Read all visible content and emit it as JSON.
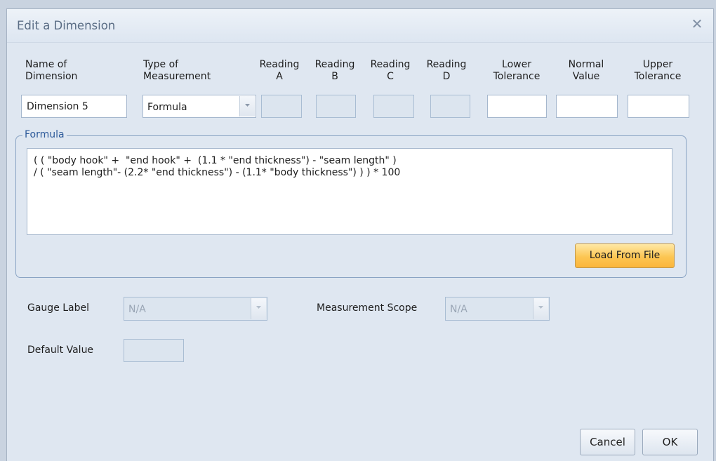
{
  "dialog": {
    "title": "Edit a Dimension",
    "close_glyph": "✕"
  },
  "columns": {
    "name_line1": "Name of",
    "name_line2": "Dimension",
    "type_line1": "Type of",
    "type_line2": "Measurement",
    "reading_a_line1": "Reading",
    "reading_a_line2": "A",
    "reading_b_line1": "Reading",
    "reading_b_line2": "B",
    "reading_c_line1": "Reading",
    "reading_c_line2": "C",
    "reading_d_line1": "Reading",
    "reading_d_line2": "D",
    "lower_line1": "Lower",
    "lower_line2": "Tolerance",
    "normal_line1": "Normal",
    "normal_line2": "Value",
    "upper_line1": "Upper",
    "upper_line2": "Tolerance"
  },
  "fields": {
    "name_value": "Dimension 5",
    "type_value": "Formula",
    "reading_a_value": "",
    "reading_b_value": "",
    "reading_c_value": "",
    "reading_d_value": "",
    "lower_value": "",
    "normal_value": "",
    "upper_value": ""
  },
  "formula": {
    "legend": "Formula",
    "line1": "( ( \"body hook\" +  \"end hook\" +  (1.1 * \"end thickness\") - \"seam length\" )",
    "line2": "/ ( \"seam length\"- (2.2* \"end thickness\") - (1.1* \"body thickness\") ) ) * 100",
    "load_button": "Load From File"
  },
  "lower_section": {
    "gauge_label": "Gauge Label",
    "gauge_value": "N/A",
    "scope_label": "Measurement Scope",
    "scope_value": "N/A",
    "default_label": "Default Value",
    "default_value": ""
  },
  "buttons": {
    "cancel": "Cancel",
    "ok": "OK"
  },
  "icons": {
    "close": "close-icon",
    "dropdown": "chevron-down-icon"
  },
  "colors": {
    "dialog_bg": "#dfe7f1",
    "accent_button": "#fcc653",
    "group_border": "#8aa4c4",
    "legend_text": "#2d5a9a"
  }
}
